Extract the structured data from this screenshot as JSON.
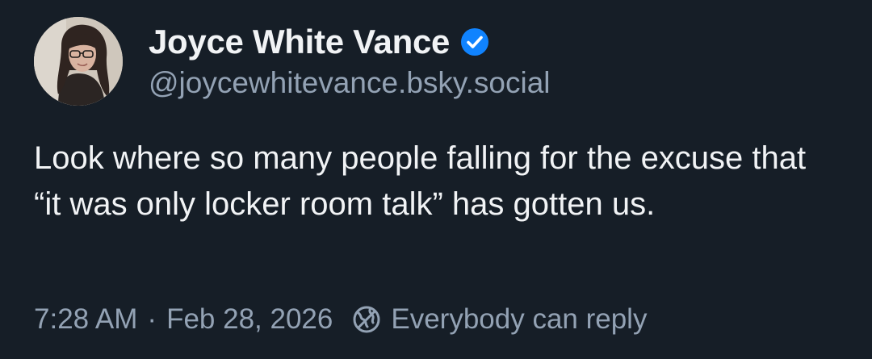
{
  "author": {
    "display_name": "Joyce White Vance",
    "handle": "@joycewhitevance.bsky.social",
    "verified_icon": "verified-check-icon",
    "avatar": "profile-photo"
  },
  "post": {
    "text": "Look where so many people falling for the excuse that “it was only locker room talk” has gotten us."
  },
  "meta": {
    "time": "7:28 AM",
    "separator": "·",
    "date": "Feb 28, 2026",
    "reply_icon": "reply-settings-globe-icon",
    "reply_setting": "Everybody can reply"
  },
  "colors": {
    "background": "#161e27",
    "primary_text": "#f1f3f5",
    "secondary_text": "#93a2b4",
    "verified_blue": "#1083fe"
  }
}
